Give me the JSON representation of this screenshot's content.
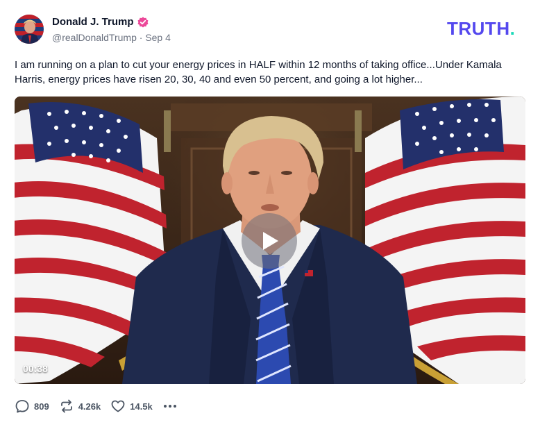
{
  "author": {
    "name": "Donald J. Trump",
    "handle": "@realDonaldTrump",
    "separator": "·",
    "date": "Sep 4",
    "verified_color": "#ec4899"
  },
  "brand": {
    "logo_text": "TRUTH.",
    "colors": {
      "logo_main": "#5448ee",
      "logo_dot": "#19d9b8"
    }
  },
  "post": {
    "text": "I am running on a plan to cut your energy prices in HALF within 12 months of taking office...Under Kamala Harris, energy prices have risen 20, 30, 40 and even 50 percent, and going a lot higher..."
  },
  "video": {
    "duration": "00:38",
    "play_icon": "play-icon"
  },
  "actions": {
    "replies": "809",
    "retruths": "4.26k",
    "likes": "14.5k",
    "more_icon": "more-icon"
  }
}
